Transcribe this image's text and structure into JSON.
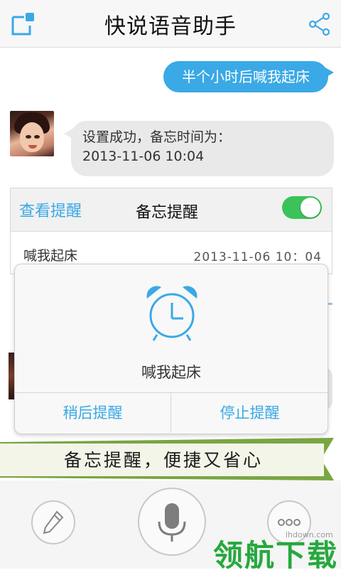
{
  "header": {
    "title": "快说语音助手",
    "left_icon": "notes-icon",
    "right_icon": "share-icon"
  },
  "chat": {
    "user_message": "半个小时后喊我起床",
    "assistant_message_line1": "设置成功，备忘时间为：",
    "assistant_message_line2": "2013-11-06  10:04"
  },
  "reminder_card": {
    "view_link": "查看提醒",
    "title": "备忘提醒",
    "toggle_on": true,
    "item_label": "喊我起床",
    "item_time": "2013-11-06  10：04"
  },
  "dialog": {
    "icon": "alarm-clock-icon",
    "message": "喊我起床",
    "snooze_label": "稍后提醒",
    "stop_label": "停止提醒"
  },
  "banner": {
    "slogan": "备忘提醒，便捷又省心"
  },
  "bottom_bar": {
    "left_icon": "pencil-icon",
    "center_icon": "microphone-icon",
    "right_icon": "more-icon"
  },
  "watermark": {
    "url": "lhdown.com",
    "text": "领航下载"
  },
  "colors": {
    "accent_blue": "#3aa9e6",
    "toggle_green": "#3cc25a",
    "ribbon_green": "#79a543"
  }
}
